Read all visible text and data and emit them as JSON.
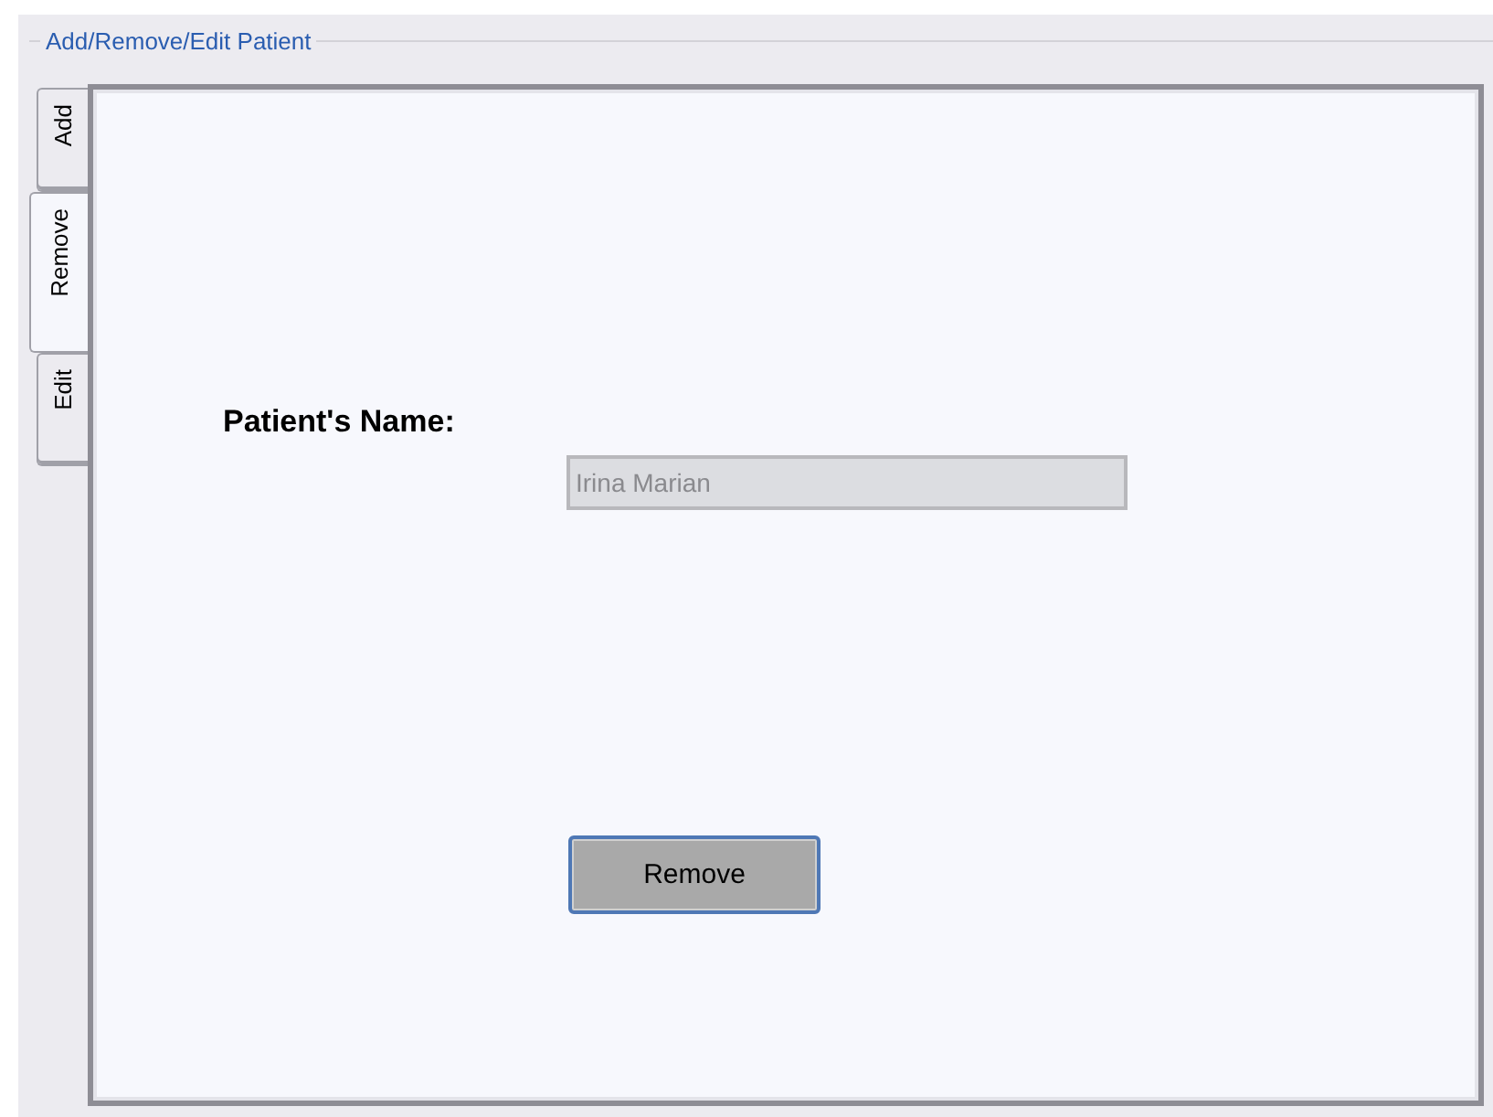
{
  "group": {
    "title": "Add/Remove/Edit Patient"
  },
  "tabs": [
    {
      "label": "Add",
      "selected": false
    },
    {
      "label": "Remove",
      "selected": true
    },
    {
      "label": "Edit",
      "selected": false
    }
  ],
  "form": {
    "label": "Patient's Name:",
    "field": {
      "value": "Irina Marian",
      "disabled": true
    },
    "button": "Remove"
  }
}
